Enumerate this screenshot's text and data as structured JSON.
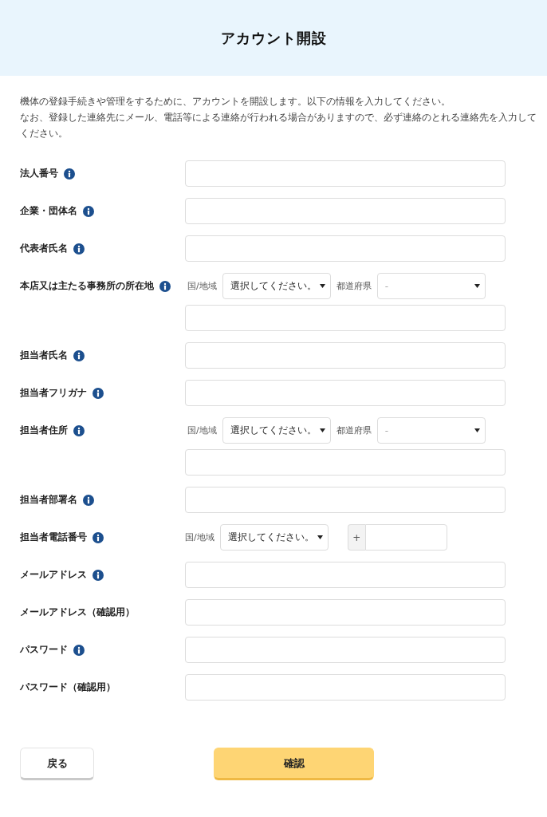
{
  "header": {
    "title": "アカウント開設"
  },
  "intro": [
    "機体の登録手続きや管理をするために、アカウントを開設します。以下の情報を入力してください。",
    "なお、登録した連絡先にメール、電話等による連絡が行われる場合がありますので、必ず連絡のとれる連絡先を入力してください。"
  ],
  "fields": [
    {
      "kind": "text",
      "label": "法人番号",
      "info": true
    },
    {
      "kind": "text",
      "label": "企業・団体名",
      "info": true
    },
    {
      "kind": "text",
      "label": "代表者氏名",
      "info": true
    },
    {
      "kind": "address",
      "label": "本店又は主たる事務所の所在地",
      "info": true,
      "country_label": "国/地域",
      "country_select": "選択してください。",
      "region_label": "都道府県",
      "region_select": "-"
    },
    {
      "kind": "text",
      "label": "担当者氏名",
      "info": true
    },
    {
      "kind": "text",
      "label": "担当者フリガナ",
      "info": true
    },
    {
      "kind": "address",
      "label": "担当者住所",
      "info": true,
      "country_label": "国/地域",
      "country_select": "選択してください。",
      "region_label": "都道府県",
      "region_select": "-"
    },
    {
      "kind": "text",
      "label": "担当者部署名",
      "info": true
    },
    {
      "kind": "phone",
      "label": "担当者電話番号",
      "info": true,
      "country_label": "国/地域",
      "country_select": "選択してください。",
      "prefix": "+"
    },
    {
      "kind": "text",
      "label": "メールアドレス",
      "info": true
    },
    {
      "kind": "text",
      "label": "メールアドレス（確認用）",
      "info": false
    },
    {
      "kind": "text",
      "label": "パスワード",
      "info": true
    },
    {
      "kind": "text",
      "label": "パスワード（確認用）",
      "info": false
    }
  ],
  "buttons": [
    {
      "kind": "secondary",
      "label": "戻る"
    },
    {
      "kind": "primary",
      "label": "確認"
    }
  ]
}
